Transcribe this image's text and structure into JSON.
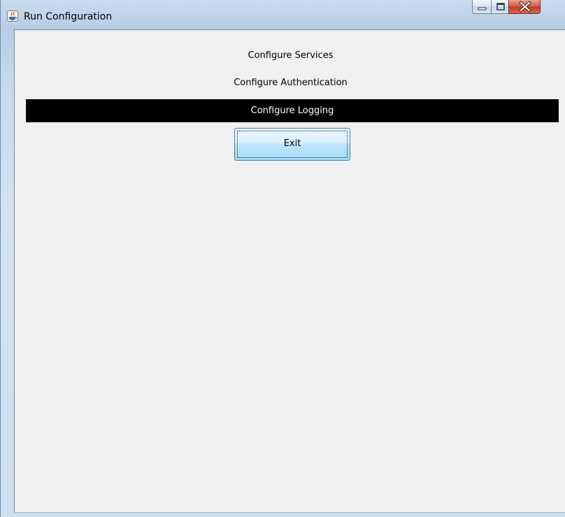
{
  "window": {
    "title": "Run Configuration",
    "app_icon": "java-cup-icon",
    "controls": {
      "minimize_icon": "minimize-icon",
      "maximize_icon": "maximize-icon",
      "close_icon": "close-icon"
    }
  },
  "menu": {
    "items": [
      {
        "label": "Configure Services",
        "selected": false
      },
      {
        "label": "Configure Authentication",
        "selected": false
      },
      {
        "label": "Configure Logging",
        "selected": true
      }
    ],
    "selection_background": "#000000",
    "selection_foreground": "#ffffff"
  },
  "exit_button": {
    "label": "Exit"
  },
  "colors": {
    "panel_background": "#f0f0f0",
    "close_button": "#c8432b",
    "button_border": "#3c7fb1"
  }
}
